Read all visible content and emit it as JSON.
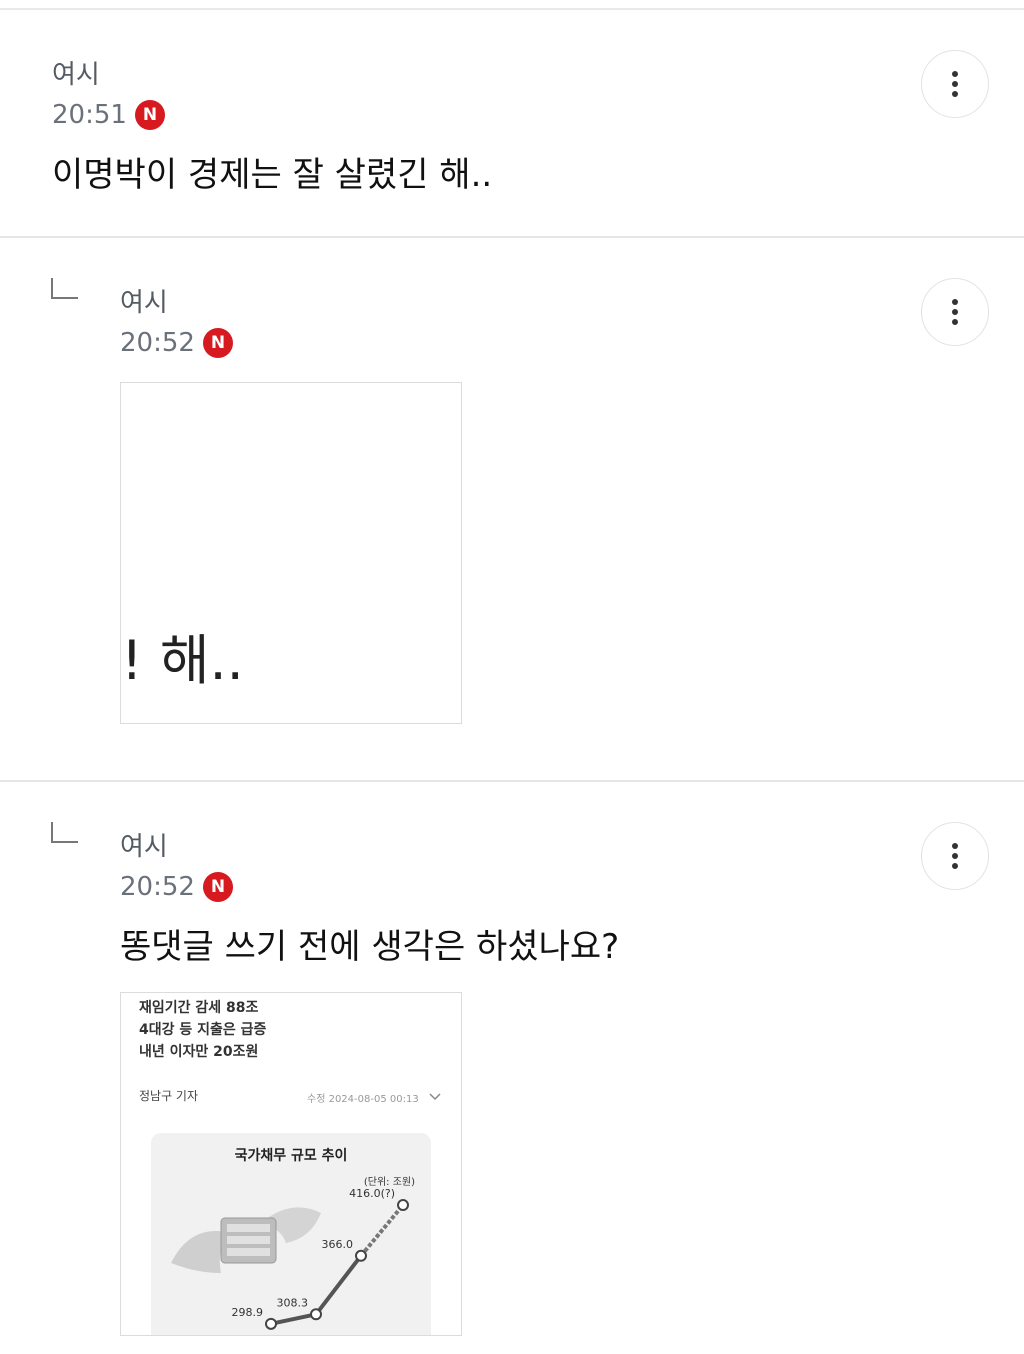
{
  "comments": [
    {
      "author": "여시",
      "time": "20:51",
      "badge": "N",
      "text": "이명박이 경제는 잘 살렸긴 해.."
    },
    {
      "author": "여시",
      "time": "20:52",
      "badge": "N",
      "image_crop_text": "! 해.."
    },
    {
      "author": "여시",
      "time": "20:52",
      "badge": "N",
      "text": "똥댓글 쓰기 전에 생각은 하셨나요?",
      "article": {
        "headline": [
          "재임기간 감세 88조",
          "4대강 등 지출은 급증",
          "내년 이자만 20조원"
        ],
        "reporter": "정남구 기자",
        "date": "수정 2024-08-05 00:13",
        "chart_data": {
          "type": "line",
          "title": "국가채무 규모 추이",
          "unit": "(단위: 조원)",
          "values": [
            298.9,
            308.3,
            366.0,
            416.0
          ],
          "value_labels": [
            "298.9",
            "308.3",
            "366.0",
            "416.0(?)"
          ]
        }
      }
    }
  ],
  "colors": {
    "badge": "#d71920",
    "divider": "#e6e6e6",
    "time": "#6b717a"
  },
  "icons": {
    "more": "vertical-dots-icon",
    "reply": "reply-arrow-icon"
  }
}
